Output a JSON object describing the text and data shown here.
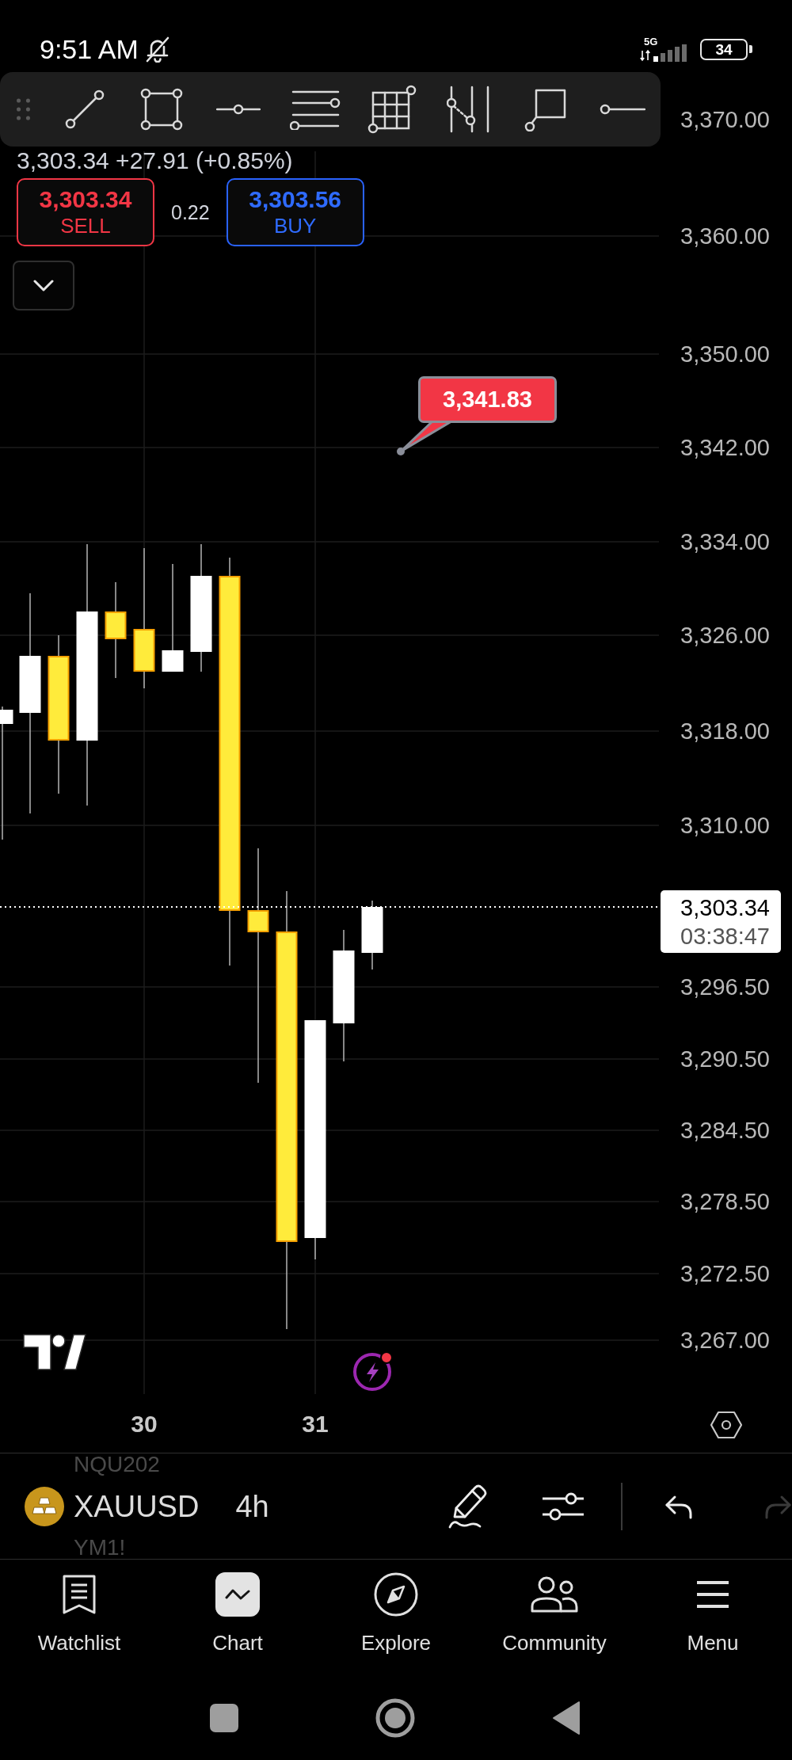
{
  "status_bar": {
    "time": "9:51 AM",
    "network": "5G",
    "battery": "34"
  },
  "quote": {
    "summary": "3,303.34 +27.91 (+0.85%)"
  },
  "trade_buttons": [
    {
      "kind": "sell",
      "price": "3,303.34",
      "label": "SELL"
    },
    {
      "kind": "buy",
      "price": "3,303.56",
      "label": "BUY"
    }
  ],
  "spread": "0.22",
  "chart": {
    "price_axis": [
      "3,370.00",
      "3,360.00",
      "3,350.00",
      "3,342.00",
      "3,334.00",
      "3,326.00",
      "3,318.00",
      "3,310.00",
      "3,296.50",
      "3,290.50",
      "3,284.50",
      "3,278.50",
      "3,272.50",
      "3,267.00"
    ],
    "current_price": {
      "price": "3,303.34",
      "countdown": "03:38:47"
    },
    "callout": "3,341.83",
    "time_axis": [
      "30",
      "31"
    ]
  },
  "symbol_bar": {
    "symbols": [
      {
        "name": "NQU202",
        "selected": false
      },
      {
        "name": "XAUUSD",
        "selected": true
      },
      {
        "name": "YM1!",
        "selected": false
      }
    ],
    "interval": "4h"
  },
  "bottom_nav": [
    {
      "label": "Watchlist",
      "selected": false
    },
    {
      "label": "Chart",
      "selected": true
    },
    {
      "label": "Explore",
      "selected": false
    },
    {
      "label": "Community",
      "selected": false
    },
    {
      "label": "Menu",
      "selected": false
    }
  ]
}
